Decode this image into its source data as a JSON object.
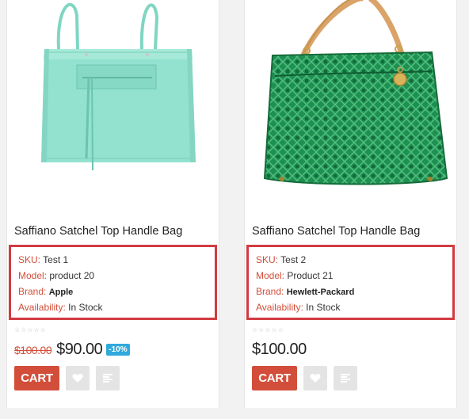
{
  "products": [
    {
      "title": "Saffiano Satchel Top Handle Bag",
      "image": "mint-tote-bag",
      "specs": {
        "sku_label": "SKU:",
        "sku": "Test 1",
        "model_label": "Model:",
        "model": "product 20",
        "brand_label": "Brand:",
        "brand": "Apple",
        "availability_label": "Availability:",
        "availability": "In Stock"
      },
      "old_price": "$100.00",
      "price": "$90.00",
      "discount": "-10%",
      "cart_label": "CART",
      "wishlist_icon": "heart-icon",
      "compare_icon": "compare-icon"
    },
    {
      "title": "Saffiano Satchel Top Handle Bag",
      "image": "green-patterned-tote-bag",
      "specs": {
        "sku_label": "SKU:",
        "sku": "Test 2",
        "model_label": "Model:",
        "model": "Product 21",
        "brand_label": "Brand:",
        "brand": "Hewlett-Packard",
        "availability_label": "Availability:",
        "availability": "In Stock"
      },
      "price": "$100.00",
      "cart_label": "CART",
      "wishlist_icon": "heart-icon",
      "compare_icon": "compare-icon"
    }
  ],
  "colors": {
    "accent": "#d24e3a",
    "highlight_border": "#d13b41",
    "discount_badge": "#30a9dc",
    "mint_bag": "#8fe0cd",
    "green_bag": "#1f8f52"
  },
  "rating_stars": 5
}
